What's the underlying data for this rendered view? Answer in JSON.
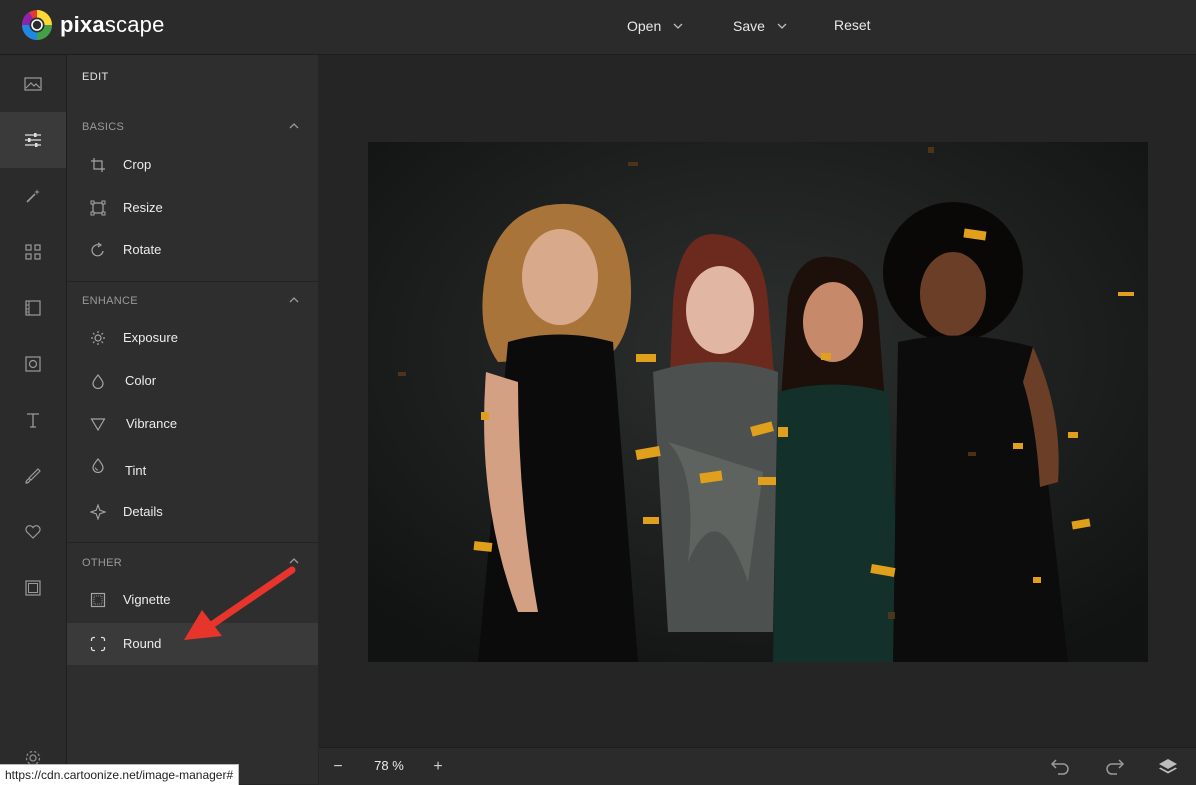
{
  "app": {
    "logo_prefix": "pixa",
    "logo_suffix": "scape"
  },
  "topmenu": {
    "open_label": "Open",
    "save_label": "Save",
    "reset_label": "Reset"
  },
  "rail": {
    "items": [
      {
        "icon": "image-icon"
      },
      {
        "icon": "sliders-icon",
        "active": true
      },
      {
        "icon": "magic-wand-icon"
      },
      {
        "icon": "grid-icon"
      },
      {
        "icon": "texture-icon"
      },
      {
        "icon": "frame-icon"
      },
      {
        "icon": "text-icon"
      },
      {
        "icon": "brush-icon"
      },
      {
        "icon": "heart-icon"
      },
      {
        "icon": "border-icon"
      }
    ]
  },
  "panel": {
    "title": "EDIT",
    "basics": {
      "heading": "BASICS",
      "items": [
        "Crop",
        "Resize",
        "Rotate"
      ]
    },
    "enhance": {
      "heading": "ENHANCE",
      "items": [
        "Exposure",
        "Color",
        "Vibrance",
        "Tint",
        "Details"
      ]
    },
    "other": {
      "heading": "OTHER",
      "items": [
        "Vignette",
        "Round"
      ]
    }
  },
  "canvas": {
    "image_alt": "Four women smiling with confetti on a dark background"
  },
  "bottombar": {
    "zoom_out": "−",
    "zoom_value": "78 %",
    "zoom_in": "+"
  },
  "status": {
    "url": "https://cdn.cartoonize.net/image-manager#"
  },
  "colors": {
    "accent_arrow": "#e8352c",
    "active_bg": "#3a3a3a",
    "panel_bg": "#2e2e2e"
  }
}
